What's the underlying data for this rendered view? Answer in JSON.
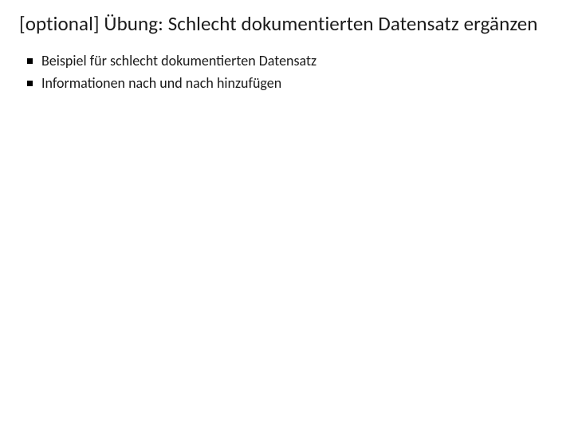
{
  "slide": {
    "title": "[optional] Übung: Schlecht dokumentierten Datensatz ergänzen",
    "bullets": [
      "Beispiel für schlecht dokumentierten Datensatz",
      "Informationen nach und nach hinzufügen"
    ]
  }
}
